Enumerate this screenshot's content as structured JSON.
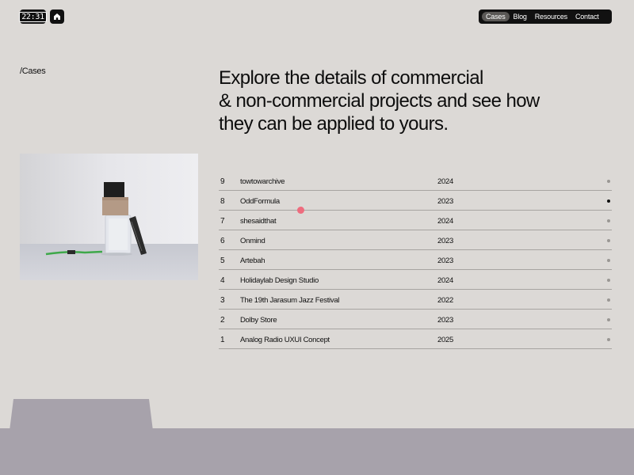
{
  "header": {
    "clock": "22:31",
    "nav": [
      {
        "label": "Cases",
        "active": true
      },
      {
        "label": "Blog",
        "active": false
      },
      {
        "label": "Resources",
        "active": false
      },
      {
        "label": "Contact",
        "active": false
      }
    ]
  },
  "breadcrumb": "/Cases",
  "headline": {
    "line1": "Explore the details of commercial",
    "line2": "& non-commercial projects and see how",
    "line3": "they can be applied to yours."
  },
  "cases": [
    {
      "num": "9",
      "name": "towtowarchive",
      "year": "2024"
    },
    {
      "num": "8",
      "name": "OddFormula",
      "year": "2023",
      "selected": true
    },
    {
      "num": "7",
      "name": "shesaidthat",
      "year": "2024"
    },
    {
      "num": "6",
      "name": "Onmind",
      "year": "2023"
    },
    {
      "num": "5",
      "name": "Artebah",
      "year": "2023"
    },
    {
      "num": "4",
      "name": "Holidaylab Design Studio",
      "year": "2024"
    },
    {
      "num": "3",
      "name": "The 19th Jarasum Jazz Festival",
      "year": "2022"
    },
    {
      "num": "2",
      "name": "Dolby Store",
      "year": "2023"
    },
    {
      "num": "1",
      "name": "Analog Radio UXUI Concept",
      "year": "2025"
    }
  ],
  "colors": {
    "background": "#dcd9d6",
    "footer": "#a7a2ab",
    "cursor": "#ee6c7e"
  }
}
